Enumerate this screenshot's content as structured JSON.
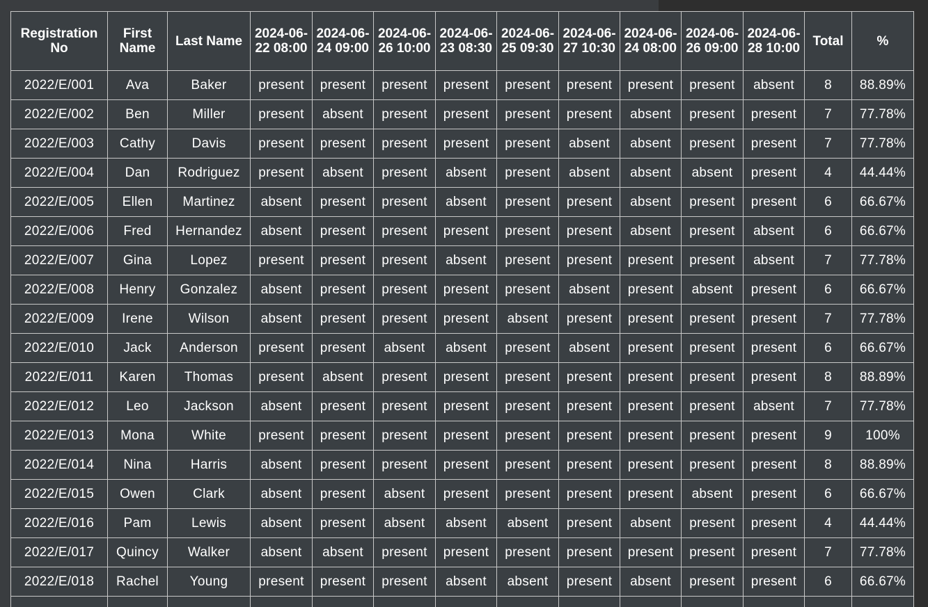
{
  "table": {
    "headers": [
      "Registration No",
      "First Name",
      "Last Name",
      "2024-06-22 08:00",
      "2024-06-24 09:00",
      "2024-06-26 10:00",
      "2024-06-23 08:30",
      "2024-06-25 09:30",
      "2024-06-27 10:30",
      "2024-06-24 08:00",
      "2024-06-26 09:00",
      "2024-06-28 10:00",
      "Total",
      "%"
    ],
    "rows": [
      [
        "2022/E/001",
        "Ava",
        "Baker",
        "present",
        "present",
        "present",
        "present",
        "present",
        "present",
        "present",
        "present",
        "absent",
        "8",
        "88.89%"
      ],
      [
        "2022/E/002",
        "Ben",
        "Miller",
        "present",
        "absent",
        "present",
        "present",
        "present",
        "present",
        "absent",
        "present",
        "present",
        "7",
        "77.78%"
      ],
      [
        "2022/E/003",
        "Cathy",
        "Davis",
        "present",
        "present",
        "present",
        "present",
        "present",
        "absent",
        "absent",
        "present",
        "present",
        "7",
        "77.78%"
      ],
      [
        "2022/E/004",
        "Dan",
        "Rodriguez",
        "present",
        "absent",
        "present",
        "absent",
        "present",
        "absent",
        "absent",
        "absent",
        "present",
        "4",
        "44.44%"
      ],
      [
        "2022/E/005",
        "Ellen",
        "Martinez",
        "absent",
        "present",
        "present",
        "absent",
        "present",
        "present",
        "absent",
        "present",
        "present",
        "6",
        "66.67%"
      ],
      [
        "2022/E/006",
        "Fred",
        "Hernandez",
        "absent",
        "present",
        "present",
        "present",
        "present",
        "present",
        "absent",
        "present",
        "absent",
        "6",
        "66.67%"
      ],
      [
        "2022/E/007",
        "Gina",
        "Lopez",
        "present",
        "present",
        "present",
        "absent",
        "present",
        "present",
        "present",
        "present",
        "absent",
        "7",
        "77.78%"
      ],
      [
        "2022/E/008",
        "Henry",
        "Gonzalez",
        "absent",
        "present",
        "present",
        "present",
        "present",
        "absent",
        "present",
        "absent",
        "present",
        "6",
        "66.67%"
      ],
      [
        "2022/E/009",
        "Irene",
        "Wilson",
        "absent",
        "present",
        "present",
        "present",
        "absent",
        "present",
        "present",
        "present",
        "present",
        "7",
        "77.78%"
      ],
      [
        "2022/E/010",
        "Jack",
        "Anderson",
        "present",
        "present",
        "absent",
        "absent",
        "present",
        "absent",
        "present",
        "present",
        "present",
        "6",
        "66.67%"
      ],
      [
        "2022/E/011",
        "Karen",
        "Thomas",
        "present",
        "absent",
        "present",
        "present",
        "present",
        "present",
        "present",
        "present",
        "present",
        "8",
        "88.89%"
      ],
      [
        "2022/E/012",
        "Leo",
        "Jackson",
        "absent",
        "present",
        "present",
        "present",
        "present",
        "present",
        "present",
        "present",
        "absent",
        "7",
        "77.78%"
      ],
      [
        "2022/E/013",
        "Mona",
        "White",
        "present",
        "present",
        "present",
        "present",
        "present",
        "present",
        "present",
        "present",
        "present",
        "9",
        "100%"
      ],
      [
        "2022/E/014",
        "Nina",
        "Harris",
        "absent",
        "present",
        "present",
        "present",
        "present",
        "present",
        "present",
        "present",
        "present",
        "8",
        "88.89%"
      ],
      [
        "2022/E/015",
        "Owen",
        "Clark",
        "absent",
        "present",
        "absent",
        "present",
        "present",
        "present",
        "present",
        "absent",
        "present",
        "6",
        "66.67%"
      ],
      [
        "2022/E/016",
        "Pam",
        "Lewis",
        "absent",
        "present",
        "absent",
        "absent",
        "absent",
        "present",
        "absent",
        "present",
        "present",
        "4",
        "44.44%"
      ],
      [
        "2022/E/017",
        "Quincy",
        "Walker",
        "absent",
        "absent",
        "present",
        "present",
        "present",
        "present",
        "present",
        "present",
        "present",
        "7",
        "77.78%"
      ],
      [
        "2022/E/018",
        "Rachel",
        "Young",
        "present",
        "present",
        "present",
        "absent",
        "absent",
        "present",
        "absent",
        "present",
        "present",
        "6",
        "66.67%"
      ],
      [
        "",
        "",
        "",
        "",
        "",
        "",
        "",
        "",
        "",
        "",
        "",
        "",
        "",
        ""
      ]
    ]
  }
}
